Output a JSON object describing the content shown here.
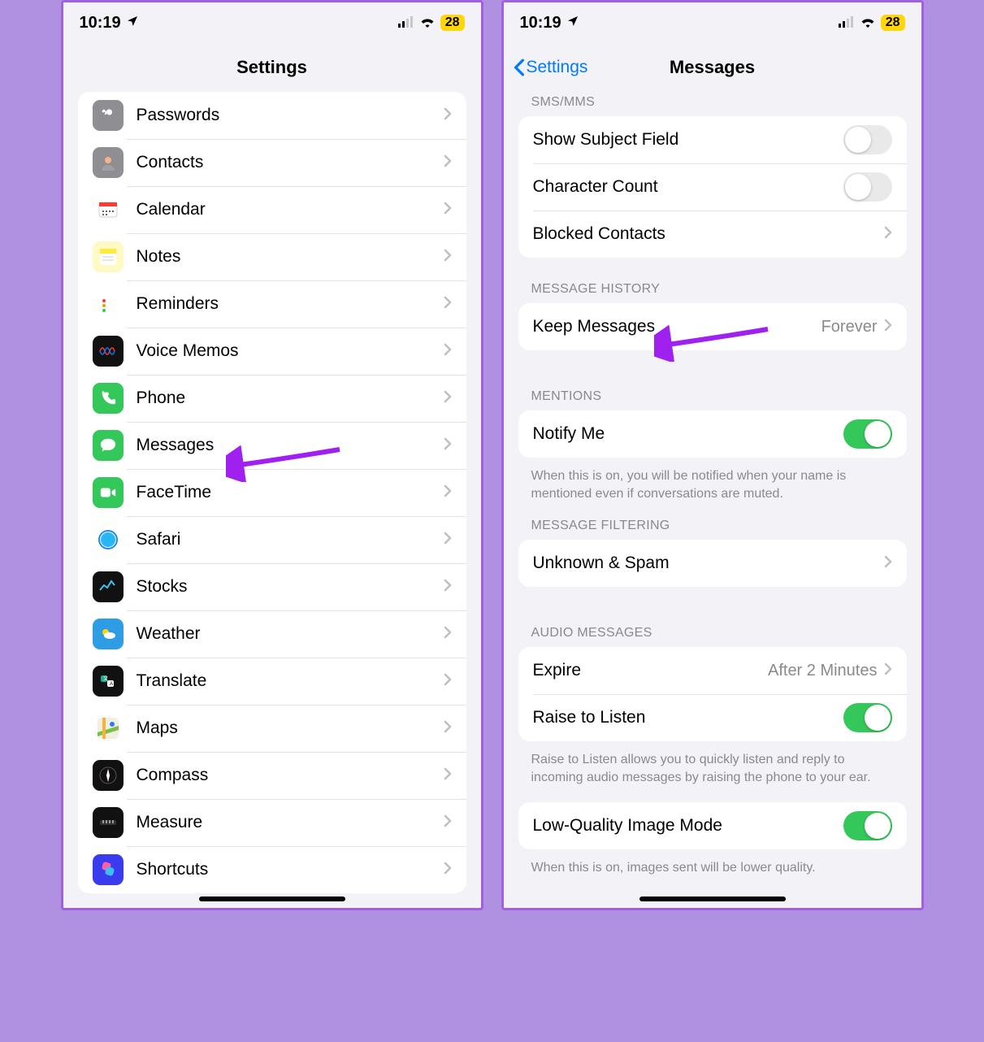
{
  "status": {
    "time": "10:19",
    "battery": "28"
  },
  "left_phone": {
    "title": "Settings",
    "items": [
      {
        "label": "Passwords",
        "icon_bg": "#8e8e93",
        "icon": "key"
      },
      {
        "label": "Contacts",
        "icon_bg": "#8e8e93",
        "icon": "contacts"
      },
      {
        "label": "Calendar",
        "icon_bg": "#ffffff",
        "icon": "calendar"
      },
      {
        "label": "Notes",
        "icon_bg": "#fff9c4",
        "icon": "notes"
      },
      {
        "label": "Reminders",
        "icon_bg": "#ffffff",
        "icon": "reminders"
      },
      {
        "label": "Voice Memos",
        "icon_bg": "#111",
        "icon": "voicememo"
      },
      {
        "label": "Phone",
        "icon_bg": "#34c759",
        "icon": "phone"
      },
      {
        "label": "Messages",
        "icon_bg": "#34c759",
        "icon": "messages"
      },
      {
        "label": "FaceTime",
        "icon_bg": "#34c759",
        "icon": "facetime"
      },
      {
        "label": "Safari",
        "icon_bg": "#ffffff",
        "icon": "safari"
      },
      {
        "label": "Stocks",
        "icon_bg": "#111",
        "icon": "stocks"
      },
      {
        "label": "Weather",
        "icon_bg": "#2f9de4",
        "icon": "weather"
      },
      {
        "label": "Translate",
        "icon_bg": "#111",
        "icon": "translate"
      },
      {
        "label": "Maps",
        "icon_bg": "#ffffff",
        "icon": "maps"
      },
      {
        "label": "Compass",
        "icon_bg": "#111",
        "icon": "compass"
      },
      {
        "label": "Measure",
        "icon_bg": "#111",
        "icon": "measure"
      },
      {
        "label": "Shortcuts",
        "icon_bg": "#3a3aef",
        "icon": "shortcuts"
      }
    ]
  },
  "right_phone": {
    "back_label": "Settings",
    "title": "Messages",
    "sections": {
      "sms": {
        "header": "SMS/MMS",
        "show_subject": "Show Subject Field",
        "char_count": "Character Count",
        "blocked": "Blocked Contacts"
      },
      "history": {
        "header": "MESSAGE HISTORY",
        "keep_label": "Keep Messages",
        "keep_value": "Forever"
      },
      "mentions": {
        "header": "MENTIONS",
        "notify": "Notify Me",
        "footer": "When this is on, you will be notified when your name is mentioned even if conversations are muted."
      },
      "filtering": {
        "header": "MESSAGE FILTERING",
        "unknown": "Unknown & Spam"
      },
      "audio": {
        "header": "AUDIO MESSAGES",
        "expire_label": "Expire",
        "expire_value": "After 2 Minutes",
        "raise": "Raise to Listen",
        "footer": "Raise to Listen allows you to quickly listen and reply to incoming audio messages by raising the phone to your ear."
      },
      "lowq": {
        "label": "Low-Quality Image Mode",
        "footer": "When this is on, images sent will be lower quality."
      }
    }
  }
}
